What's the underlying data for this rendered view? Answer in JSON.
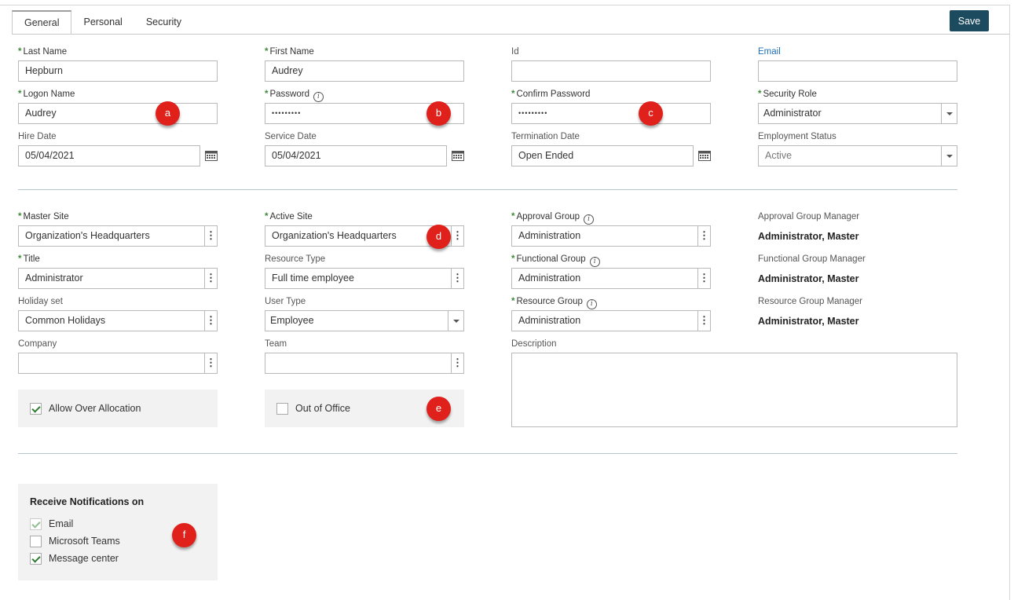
{
  "tabs": [
    {
      "label": "General"
    },
    {
      "label": "Personal"
    },
    {
      "label": "Security"
    }
  ],
  "toolbar": {
    "save_label": "Save"
  },
  "fields": {
    "last_name": {
      "label": "Last Name",
      "value": "Hepburn"
    },
    "first_name": {
      "label": "First Name",
      "value": "Audrey"
    },
    "id": {
      "label": "Id",
      "value": ""
    },
    "email": {
      "label": "Email",
      "value": ""
    },
    "logon_name": {
      "label": "Logon Name",
      "value": "Audrey"
    },
    "password": {
      "label": "Password",
      "value": "•••••••••"
    },
    "confirm_password": {
      "label": "Confirm Password",
      "value": "•••••••••"
    },
    "security_role": {
      "label": "Security Role",
      "value": "Administrator"
    },
    "hire_date": {
      "label": "Hire Date",
      "value": "05/04/2021"
    },
    "service_date": {
      "label": "Service Date",
      "value": "05/04/2021"
    },
    "termination_date": {
      "label": "Termination Date",
      "value": "Open Ended"
    },
    "employment_status": {
      "label": "Employment Status",
      "value": "Active"
    },
    "master_site": {
      "label": "Master Site",
      "value": "Organization's Headquarters"
    },
    "active_site": {
      "label": "Active Site",
      "value": "Organization's Headquarters"
    },
    "approval_group": {
      "label": "Approval Group",
      "value": "Administration"
    },
    "approval_group_manager": {
      "label": "Approval Group Manager",
      "value": "Administrator, Master"
    },
    "title": {
      "label": "Title",
      "value": "Administrator"
    },
    "resource_type": {
      "label": "Resource Type",
      "value": "Full time employee"
    },
    "functional_group": {
      "label": "Functional Group",
      "value": "Administration"
    },
    "functional_group_manager": {
      "label": "Functional Group Manager",
      "value": "Administrator, Master"
    },
    "holiday_set": {
      "label": "Holiday set",
      "value": "Common Holidays"
    },
    "user_type": {
      "label": "User Type",
      "value": "Employee"
    },
    "resource_group": {
      "label": "Resource Group",
      "value": "Administration"
    },
    "resource_group_manager": {
      "label": "Resource Group Manager",
      "value": "Administrator, Master"
    },
    "company": {
      "label": "Company",
      "value": ""
    },
    "team": {
      "label": "Team",
      "value": ""
    },
    "description": {
      "label": "Description",
      "value": ""
    }
  },
  "checkboxes": {
    "allow_over_allocation": {
      "label": "Allow Over Allocation",
      "checked": true
    },
    "out_of_office": {
      "label": "Out of Office",
      "checked": false
    }
  },
  "notifications": {
    "title": "Receive Notifications on",
    "options": [
      {
        "label": "Email",
        "checked": true,
        "disabled": true
      },
      {
        "label": "Microsoft Teams",
        "checked": false
      },
      {
        "label": "Message center",
        "checked": true
      }
    ]
  },
  "markers": [
    "a",
    "b",
    "c",
    "d",
    "e",
    "f"
  ],
  "icons": {
    "info": "i",
    "calendar": "calendar-icon",
    "kebab": "⋮"
  },
  "colors": {
    "save_bg": "#1c4a5e",
    "required_star": "#3d8b3d",
    "marker": "#e0201b",
    "email_label": "#1f6fb5"
  }
}
